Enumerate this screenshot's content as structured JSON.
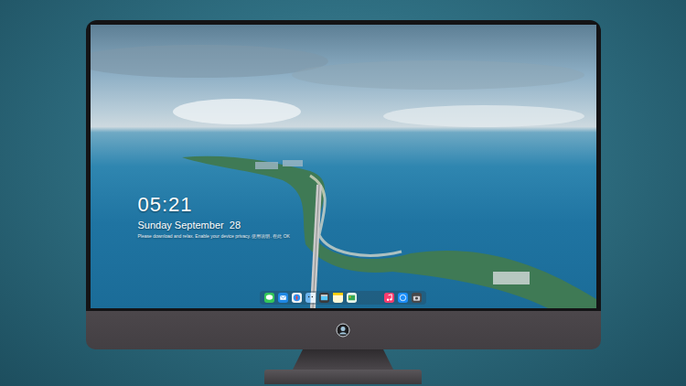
{
  "lock_screen": {
    "time": "05:21",
    "date": "Sunday September  28",
    "notice": "Please download and relax. Enable your device privacy. 使用说明. 在此 OK"
  }
}
